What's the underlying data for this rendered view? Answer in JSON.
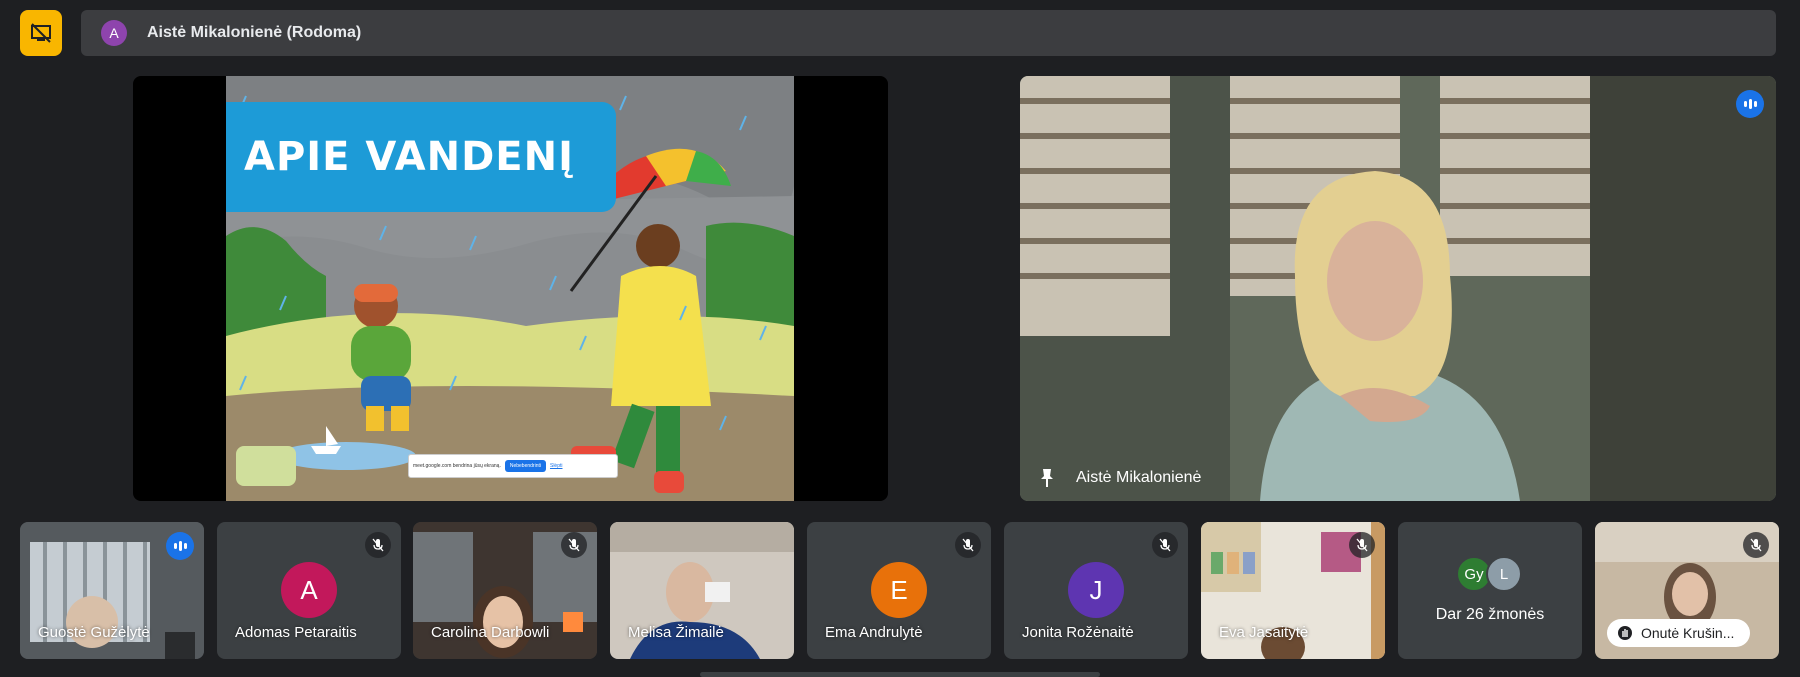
{
  "header": {
    "presenter_avatar_letter": "A",
    "presenter_title": "Aistė Mikalonienė (Rodoma)"
  },
  "presentation": {
    "slide_title": "APIE VANDENĮ",
    "share_bar_text": "meet.google.com bendrina jūsų ekraną.",
    "stop_sharing": "Nebebendrinti",
    "hide": "Slėpti"
  },
  "speaker": {
    "name": "Aistė Mikalonienė"
  },
  "participants": [
    {
      "name": "Guostė Gužėlytė"
    },
    {
      "name": "Adomas Petaraitis",
      "avatar": "A",
      "color": "#c2185b"
    },
    {
      "name": "Carolina Darbowli"
    },
    {
      "name": "Melisa Žimailė"
    },
    {
      "name": "Ema Andrulytė",
      "avatar": "E",
      "color": "#e8710a"
    },
    {
      "name": "Jonita Rožėnaitė",
      "avatar": "J",
      "color": "#5e35b1"
    },
    {
      "name": "Eva Jasaitytė"
    },
    {
      "more_label": "Dar 26 žmonės",
      "avatars": [
        "Gy",
        "L"
      ]
    },
    {
      "name": "Onutė Krušin..."
    }
  ],
  "colors": {
    "accent_blue": "#1a73e8",
    "present_yellow": "#f9b600",
    "background": "#1e1f22"
  }
}
